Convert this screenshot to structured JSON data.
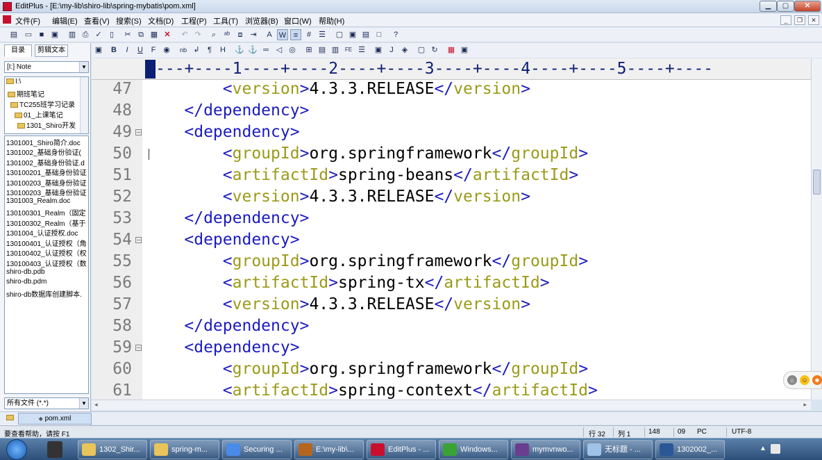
{
  "window": {
    "title": "EditPlus - [E:\\my-lib\\shiro-lib\\spring-mybatis\\pom.xml]"
  },
  "menu": [
    "文件(F)",
    "编辑(E)",
    "查看(V)",
    "搜索(S)",
    "文档(D)",
    "工程(P)",
    "工具(T)",
    "浏览器(B)",
    "窗口(W)",
    "帮助(H)"
  ],
  "sidebar": {
    "tabs": [
      "目录",
      "剪辑文本"
    ],
    "drive_select": "[I:] Note",
    "tree": [
      "I:\\",
      "期班笔记",
      "TC255班学习记录",
      "01_上课笔记",
      "1301_Shiro开发"
    ],
    "files": [
      "1301001_Shiro简介.doc",
      "1301002_基础身份验证(",
      "1301002_基础身份验证.d",
      "130100201_基础身份验证",
      "130100203_基础身份验证",
      "130100203_基础身份验证",
      "1301003_Realm.doc",
      "130100301_Realm（固定",
      "130100302_Realm（基于",
      "1301004_认证授权.doc",
      "130100401_认证授权（角",
      "130100402_认证授权（权",
      "130100403_认证授权（数",
      "shiro-db.pdb",
      "shiro-db.pdm",
      "shiro-db数据库创建脚本."
    ],
    "filter_select": "所有文件 (*.*)"
  },
  "ruler": "---+----1----+----2----+----3----+----4----+----5----+----",
  "editor": {
    "lines": [
      {
        "num": "47",
        "indent": "        ",
        "kind": "leaf",
        "tag": "version",
        "text": "4.3.3.RELEASE"
      },
      {
        "num": "48",
        "indent": "    ",
        "kind": "close",
        "tag": "dependency"
      },
      {
        "num": "49",
        "indent": "    ",
        "kind": "open",
        "tag": "dependency",
        "fold": "⊟"
      },
      {
        "num": "50",
        "indent": "        ",
        "kind": "leaf",
        "tag": "groupId",
        "text": "org.springframework"
      },
      {
        "num": "51",
        "indent": "        ",
        "kind": "leaf",
        "tag": "artifactId",
        "text": "spring-beans"
      },
      {
        "num": "52",
        "indent": "        ",
        "kind": "leaf",
        "tag": "version",
        "text": "4.3.3.RELEASE"
      },
      {
        "num": "53",
        "indent": "    ",
        "kind": "close",
        "tag": "dependency"
      },
      {
        "num": "54",
        "indent": "    ",
        "kind": "open",
        "tag": "dependency",
        "fold": "⊟"
      },
      {
        "num": "55",
        "indent": "        ",
        "kind": "leaf",
        "tag": "groupId",
        "text": "org.springframework"
      },
      {
        "num": "56",
        "indent": "        ",
        "kind": "leaf",
        "tag": "artifactId",
        "text": "spring-tx"
      },
      {
        "num": "57",
        "indent": "        ",
        "kind": "leaf",
        "tag": "version",
        "text": "4.3.3.RELEASE"
      },
      {
        "num": "58",
        "indent": "    ",
        "kind": "close",
        "tag": "dependency"
      },
      {
        "num": "59",
        "indent": "    ",
        "kind": "open",
        "tag": "dependency",
        "fold": "⊟"
      },
      {
        "num": "60",
        "indent": "        ",
        "kind": "leaf",
        "tag": "groupId",
        "text": "org.springframework"
      },
      {
        "num": "61",
        "indent": "        ",
        "kind": "leaf",
        "tag": "artifactId",
        "text": "spring-context"
      }
    ]
  },
  "doc_tab": "pom.xml",
  "status": {
    "help": "要查看帮助，请按 F1",
    "line": "行 32",
    "col": "列 1",
    "chars": "148",
    "cols2": "09",
    "mode": "PC",
    "encoding": "UTF-8"
  },
  "taskbar": [
    {
      "label": "1302_Shir...",
      "color": "#e8c45a"
    },
    {
      "label": "spring-m...",
      "color": "#e8c45a"
    },
    {
      "label": "Securing ...",
      "color": "#4b8be8"
    },
    {
      "label": "E:\\my-lib\\...",
      "color": "#b5651d"
    },
    {
      "label": "EditPlus - ...",
      "color": "#c8102e"
    },
    {
      "label": "Windows...",
      "color": "#3aa335"
    },
    {
      "label": "mymvnwo...",
      "color": "#6a3d8f"
    },
    {
      "label": "无标题 - ...",
      "color": "#9fc3e8"
    },
    {
      "label": "1302002_...",
      "color": "#2b5797"
    }
  ]
}
